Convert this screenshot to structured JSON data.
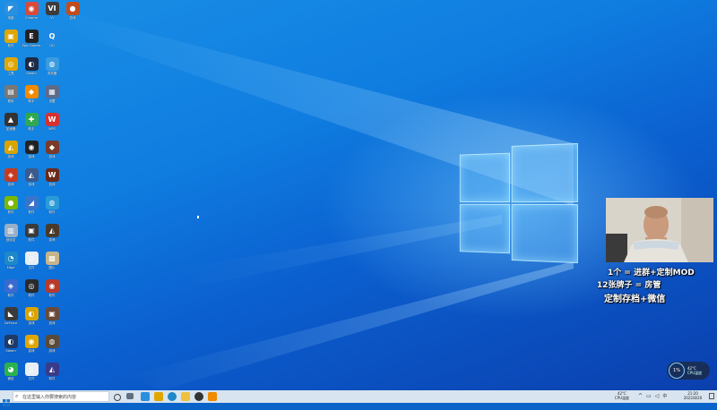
{
  "desktop_icons": [
    {
      "label": "电脑",
      "icon": "vscode-icon",
      "color": "#2b8fe0",
      "glyph": "◤",
      "col": 0,
      "row": 0
    },
    {
      "label": "Chrome",
      "icon": "chrome-icon",
      "color": "#d84a3a",
      "glyph": "◉",
      "col": 1,
      "row": 0
    },
    {
      "label": "VI",
      "icon": "vi-icon",
      "color": "#3c3c3c",
      "glyph": "VI",
      "col": 2,
      "row": 0
    },
    {
      "label": "游戏",
      "icon": "game-icon",
      "color": "#c24d1c",
      "glyph": "●",
      "col": 3,
      "row": 0
    },
    {
      "label": "软件",
      "icon": "app-icon",
      "color": "#e0a600",
      "glyph": "▣",
      "col": 0,
      "row": 1
    },
    {
      "label": "Epic Games",
      "icon": "epic-games-icon",
      "color": "#222222",
      "glyph": "E",
      "col": 1,
      "row": 1
    },
    {
      "label": "QQ",
      "icon": "qq-icon",
      "color": "#1e88e5",
      "glyph": "Q",
      "col": 2,
      "row": 1
    },
    {
      "label": "工具",
      "icon": "tool-icon",
      "color": "#e0a600",
      "glyph": "◎",
      "col": 0,
      "row": 2
    },
    {
      "label": "Steam",
      "icon": "steam-icon",
      "color": "#1f2a44",
      "glyph": "◐",
      "col": 1,
      "row": 2
    },
    {
      "label": "浏览器",
      "icon": "browser-icon",
      "color": "#3a9be0",
      "glyph": "◍",
      "col": 2,
      "row": 2
    },
    {
      "label": "程序",
      "icon": "program-icon",
      "color": "#777777",
      "glyph": "▤",
      "col": 0,
      "row": 3
    },
    {
      "label": "助手",
      "icon": "assistant-icon",
      "color": "#f08a00",
      "glyph": "◆",
      "col": 1,
      "row": 3
    },
    {
      "label": "设置",
      "icon": "settings-icon",
      "color": "#5d6b8a",
      "glyph": "▦",
      "col": 2,
      "row": 3
    },
    {
      "label": "加速器",
      "icon": "accelerator-icon",
      "color": "#333333",
      "glyph": "▲",
      "col": 0,
      "row": 4
    },
    {
      "label": "助手",
      "icon": "helper-icon",
      "color": "#2fa84f",
      "glyph": "✚",
      "col": 1,
      "row": 4
    },
    {
      "label": "WPS",
      "icon": "wps-icon",
      "color": "#d6302f",
      "glyph": "W",
      "col": 2,
      "row": 4
    },
    {
      "label": "游戏",
      "icon": "game-2-icon",
      "color": "#d9a400",
      "glyph": "◭",
      "col": 0,
      "row": 5
    },
    {
      "label": "游戏",
      "icon": "game-3-icon",
      "color": "#222222",
      "glyph": "◉",
      "col": 1,
      "row": 5
    },
    {
      "label": "游戏",
      "icon": "game-4-icon",
      "color": "#7a3b2a",
      "glyph": "◆",
      "col": 2,
      "row": 5
    },
    {
      "label": "游戏",
      "icon": "game-5-icon",
      "color": "#c83a20",
      "glyph": "◈",
      "col": 0,
      "row": 6
    },
    {
      "label": "游戏",
      "icon": "game-6-icon",
      "color": "#3c5a8c",
      "glyph": "◭",
      "col": 1,
      "row": 6
    },
    {
      "label": "游戏",
      "icon": "game-7-icon",
      "color": "#6a2a1a",
      "glyph": "W",
      "col": 2,
      "row": 6
    },
    {
      "label": "软件",
      "icon": "app-2-icon",
      "color": "#7bb800",
      "glyph": "●",
      "col": 0,
      "row": 7
    },
    {
      "label": "软件",
      "icon": "app-3-icon",
      "color": "#3a74c8",
      "glyph": "◢",
      "col": 1,
      "row": 7
    },
    {
      "label": "软件",
      "icon": "app-4-icon",
      "color": "#2a9bd6",
      "glyph": "◍",
      "col": 2,
      "row": 7
    },
    {
      "label": "回收站",
      "icon": "recycle-bin-icon",
      "color": "#9ab0c8",
      "glyph": "▥",
      "col": 0,
      "row": 8
    },
    {
      "label": "软件",
      "icon": "app-5-icon",
      "color": "#3a3a3a",
      "glyph": "▣",
      "col": 1,
      "row": 8
    },
    {
      "label": "游戏",
      "icon": "game-8-icon",
      "color": "#4a3a2a",
      "glyph": "◭",
      "col": 2,
      "row": 8
    },
    {
      "label": "Edge",
      "icon": "edge-icon",
      "color": "#1e88c8",
      "glyph": "◔",
      "col": 0,
      "row": 9
    },
    {
      "label": "文件",
      "icon": "file-icon",
      "color": "#e8eef5",
      "glyph": "▯",
      "col": 1,
      "row": 9
    },
    {
      "label": "图片",
      "icon": "image-icon",
      "color": "#c8b48a",
      "glyph": "▩",
      "col": 2,
      "row": 9
    },
    {
      "label": "软件",
      "icon": "app-6-icon",
      "color": "#3a6ad0",
      "glyph": "◈",
      "col": 0,
      "row": 10
    },
    {
      "label": "软件",
      "icon": "app-7-icon",
      "color": "#2a2a2a",
      "glyph": "◎",
      "col": 1,
      "row": 10
    },
    {
      "label": "软件",
      "icon": "app-8-icon",
      "color": "#b83a2a",
      "glyph": "◉",
      "col": 2,
      "row": 10
    },
    {
      "label": "GeForce",
      "icon": "nvidia-icon",
      "color": "#3a3a3a",
      "glyph": "◣",
      "col": 0,
      "row": 11
    },
    {
      "label": "游戏",
      "icon": "game-9-icon",
      "color": "#d9a400",
      "glyph": "◐",
      "col": 1,
      "row": 11
    },
    {
      "label": "游戏",
      "icon": "game-10-icon",
      "color": "#6a4a3a",
      "glyph": "▣",
      "col": 2,
      "row": 11
    },
    {
      "label": "Steam",
      "icon": "steam-2-icon",
      "color": "#1f3a66",
      "glyph": "◐",
      "col": 0,
      "row": 12
    },
    {
      "label": "游戏",
      "icon": "game-11-icon",
      "color": "#e0a600",
      "glyph": "◉",
      "col": 1,
      "row": 12
    },
    {
      "label": "游戏",
      "icon": "game-12-icon",
      "color": "#5a4a3a",
      "glyph": "◍",
      "col": 2,
      "row": 12
    },
    {
      "label": "微信",
      "icon": "wechat-icon",
      "color": "#2bb24c",
      "glyph": "◕",
      "col": 0,
      "row": 13
    },
    {
      "label": "文件",
      "icon": "file-2-icon",
      "color": "#e8eef5",
      "glyph": "▯",
      "col": 1,
      "row": 13
    },
    {
      "label": "软件",
      "icon": "app-9-icon",
      "color": "#3a3a8a",
      "glyph": "◭",
      "col": 2,
      "row": 13
    }
  ],
  "overlay": {
    "line1": "1个 = 进群+定制MOD",
    "line2": "12张牌子 = 房管",
    "line3": "定制存档+微信"
  },
  "taskbar": {
    "search_placeholder": "在这里输入你要搜索的内容",
    "weather": "42°C",
    "weather_desc": "CPU温度",
    "time": "21:20",
    "date": "2022/8/20",
    "perf_badge": "1%",
    "perf_label_1": "42°C",
    "perf_label_2": "CPU温度"
  }
}
